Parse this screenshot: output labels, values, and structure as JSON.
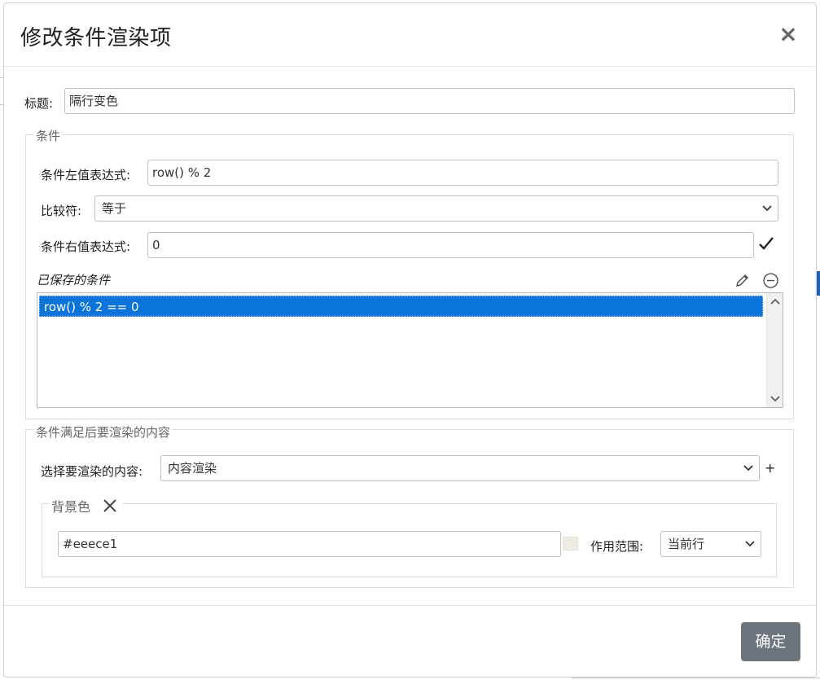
{
  "dialog": {
    "title": "修改条件渲染项",
    "close_icon": "close-icon",
    "title_field": {
      "label": "标题:",
      "value": "隔行变色"
    }
  },
  "condition": {
    "legend": "条件",
    "left_expr": {
      "label": "条件左值表达式:",
      "value": "row() % 2"
    },
    "comparator": {
      "label": "比较符:",
      "value": "等于"
    },
    "right_expr": {
      "label": "条件右值表达式:",
      "value": "0"
    },
    "saved_label": "已保存的条件",
    "saved_items": [
      "row() % 2 == 0"
    ]
  },
  "render": {
    "legend": "条件满足后要渲染的内容",
    "content_select": {
      "label": "选择要渲染的内容:",
      "value": "内容渲染"
    },
    "add_symbol": "+",
    "background": {
      "legend": "背景色",
      "color_value": "#eeece1",
      "swatch_color": "#eeece1",
      "scope_label": "作用范围:",
      "scope_value": "当前行"
    }
  },
  "footer": {
    "ok_label": "确定"
  }
}
